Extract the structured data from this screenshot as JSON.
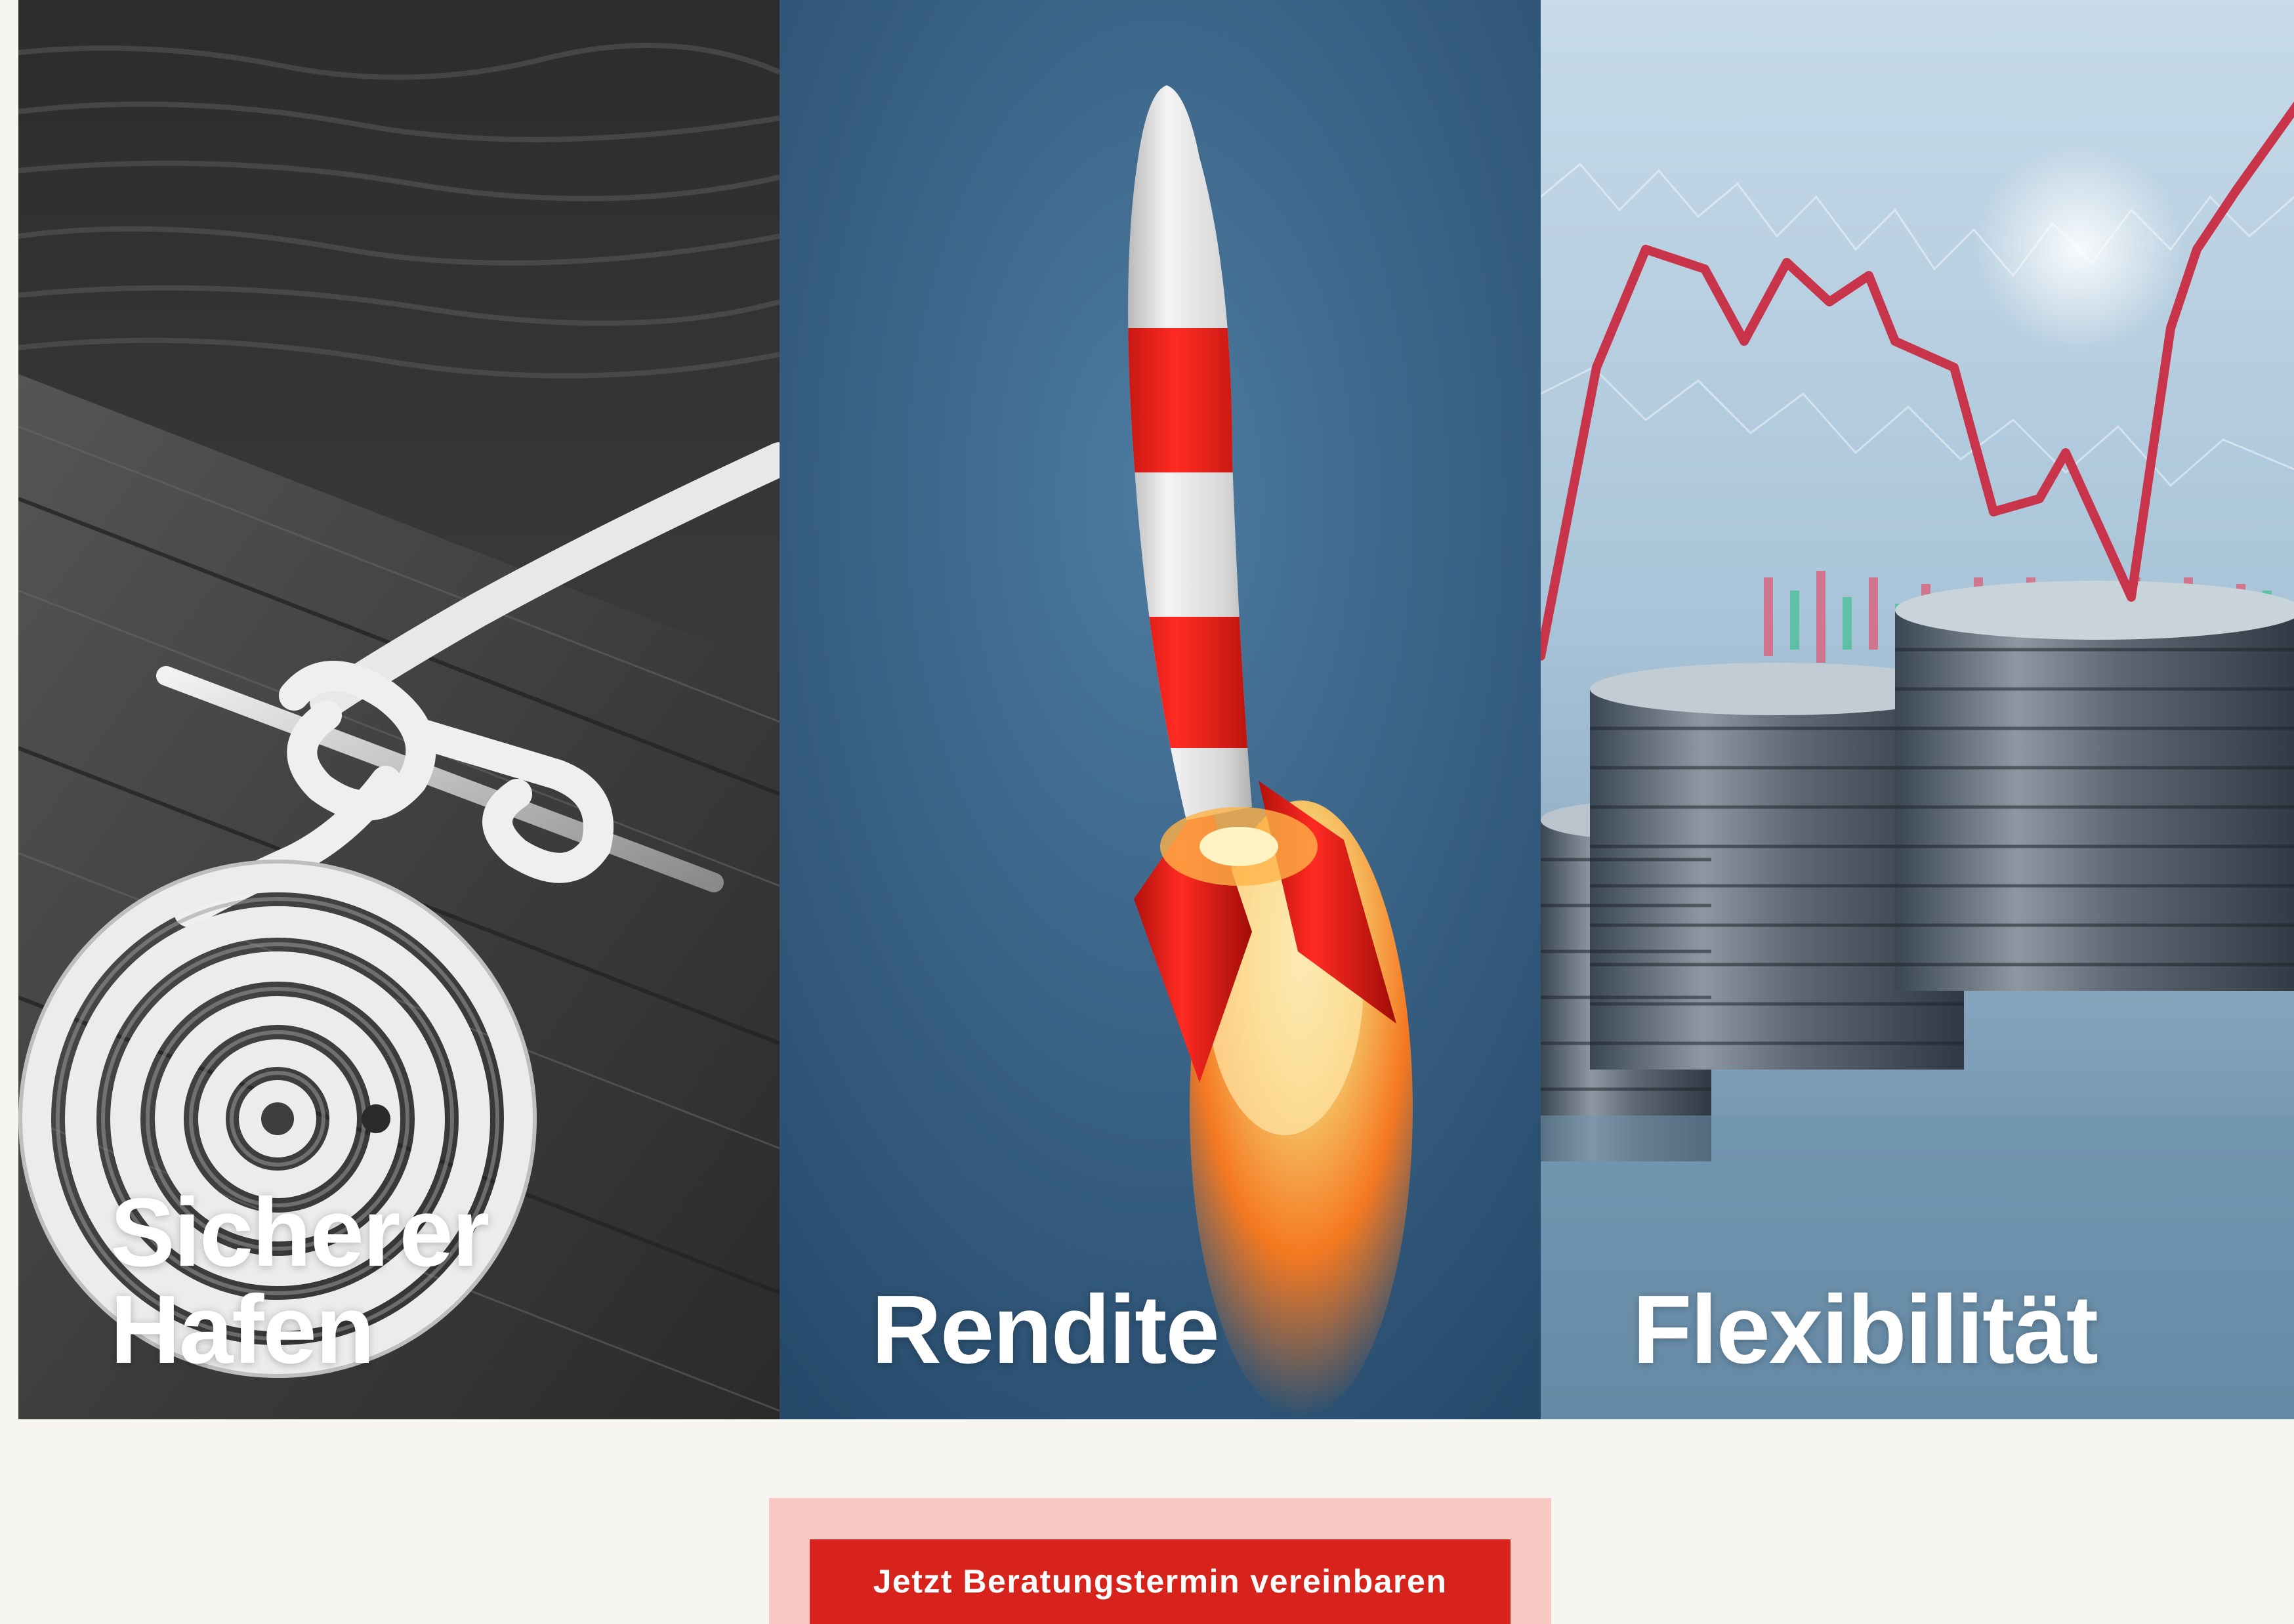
{
  "cards": [
    {
      "title": "Sicherer\nHafen",
      "image": "rope-on-dock"
    },
    {
      "title": "Rendite",
      "image": "rocket"
    },
    {
      "title": "Flexibilität",
      "image": "coins-stock-chart"
    }
  ],
  "cta": {
    "label": "Jetzt Beratungstermin vereinbaren"
  },
  "colors": {
    "page_background": "#f6f5f0",
    "cta_frame": "#f7c7c2",
    "cta_button": "#d8231d",
    "card_title": "#ffffff"
  }
}
